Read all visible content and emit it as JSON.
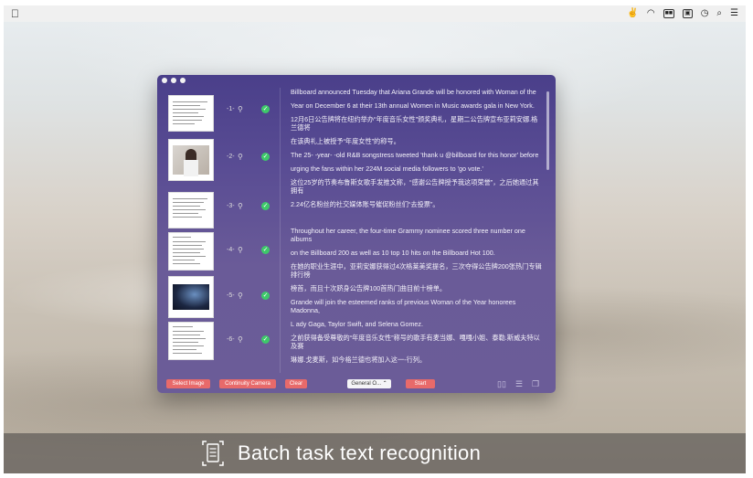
{
  "menubar": {
    "apple": "",
    "right_items": [
      "",
      "",
      "",
      "",
      "",
      "",
      ""
    ],
    "right_icons": [
      "app-icon",
      "wifi-icon",
      "battery-icon",
      "screen-icon",
      "clock-icon",
      "search-icon",
      "list-icon"
    ]
  },
  "window": {
    "thumbnails": [
      {
        "num": "-1-",
        "type": "text"
      },
      {
        "num": "-2-",
        "type": "photo"
      },
      {
        "num": "-3-",
        "type": "text"
      },
      {
        "num": "-4-",
        "type": "text"
      },
      {
        "num": "-5-",
        "type": "photo"
      },
      {
        "num": "-6-",
        "type": "text"
      }
    ],
    "text": [
      "Billboard announced Tuesday that Ariana Grande will be honored with Woman of the",
      "Year on December 6 at their 13th annual Women in Music awards gala in New York.",
      "12月6日公告牌将在纽约举办“年度音乐女性”颁奖典礼，星期二公告牌宣布亚莉安娜.格兰德将",
      "在该典礼上被授予“年度女性”的称号。",
      "The 25- -year- -old R&B songstress tweeted 'thank u @billboard for this honor' before",
      "urging the fans within her 224M social media followers to 'go vote.'",
      "这位25岁的节奏布鲁斯女歌手发推文称，“感谢公告牌授予我这项荣誉”，之后她通过其拥有",
      "2.24亿名粉丝的社交媒体账号催促粉丝们“去投票”。",
      "",
      "Throughout her career, the four-time Grammy nominee scored three number one albums",
      "on the Billboard 200 as well as 10 top 10 hits on the Billboard Hot 100.",
      "在她的职业生涯中，亚莉安娜获得过4次格莱美奖提名，三次夺得公告牌200张热门专辑排行榜",
      "榜首，而且十次跻身公告牌100首热门曲目前十榜单。",
      "Grande will join the esteemed ranks of previous Woman of the Year honorees Madonna,",
      "L ady Gaga, Taylor Swift, and Selena Gomez.",
      "之前获得备受尊敬的“年度音乐女性”称号的歌手有麦当娜、嘎嘎小姐、泰勒.斯威夫特以及赛",
      "琳娜.戈麦斯，如今格兰德也将加入这一-行列。"
    ],
    "buttons": {
      "select_image": "Select Image",
      "continuity_camera": "Continuity Camera",
      "clear": "Clear",
      "language": "General O... ⌃",
      "start": "Start"
    },
    "tool_icons": [
      "book-icon",
      "list-view-icon",
      "layers-icon"
    ]
  },
  "banner": {
    "text": "Batch task text recognition",
    "icon": "document-scan-icon"
  },
  "colors": {
    "window_top": "#4a3f8a",
    "window_bottom": "#6b5c98",
    "button": "#e86a6a",
    "check": "#3ec96a"
  }
}
